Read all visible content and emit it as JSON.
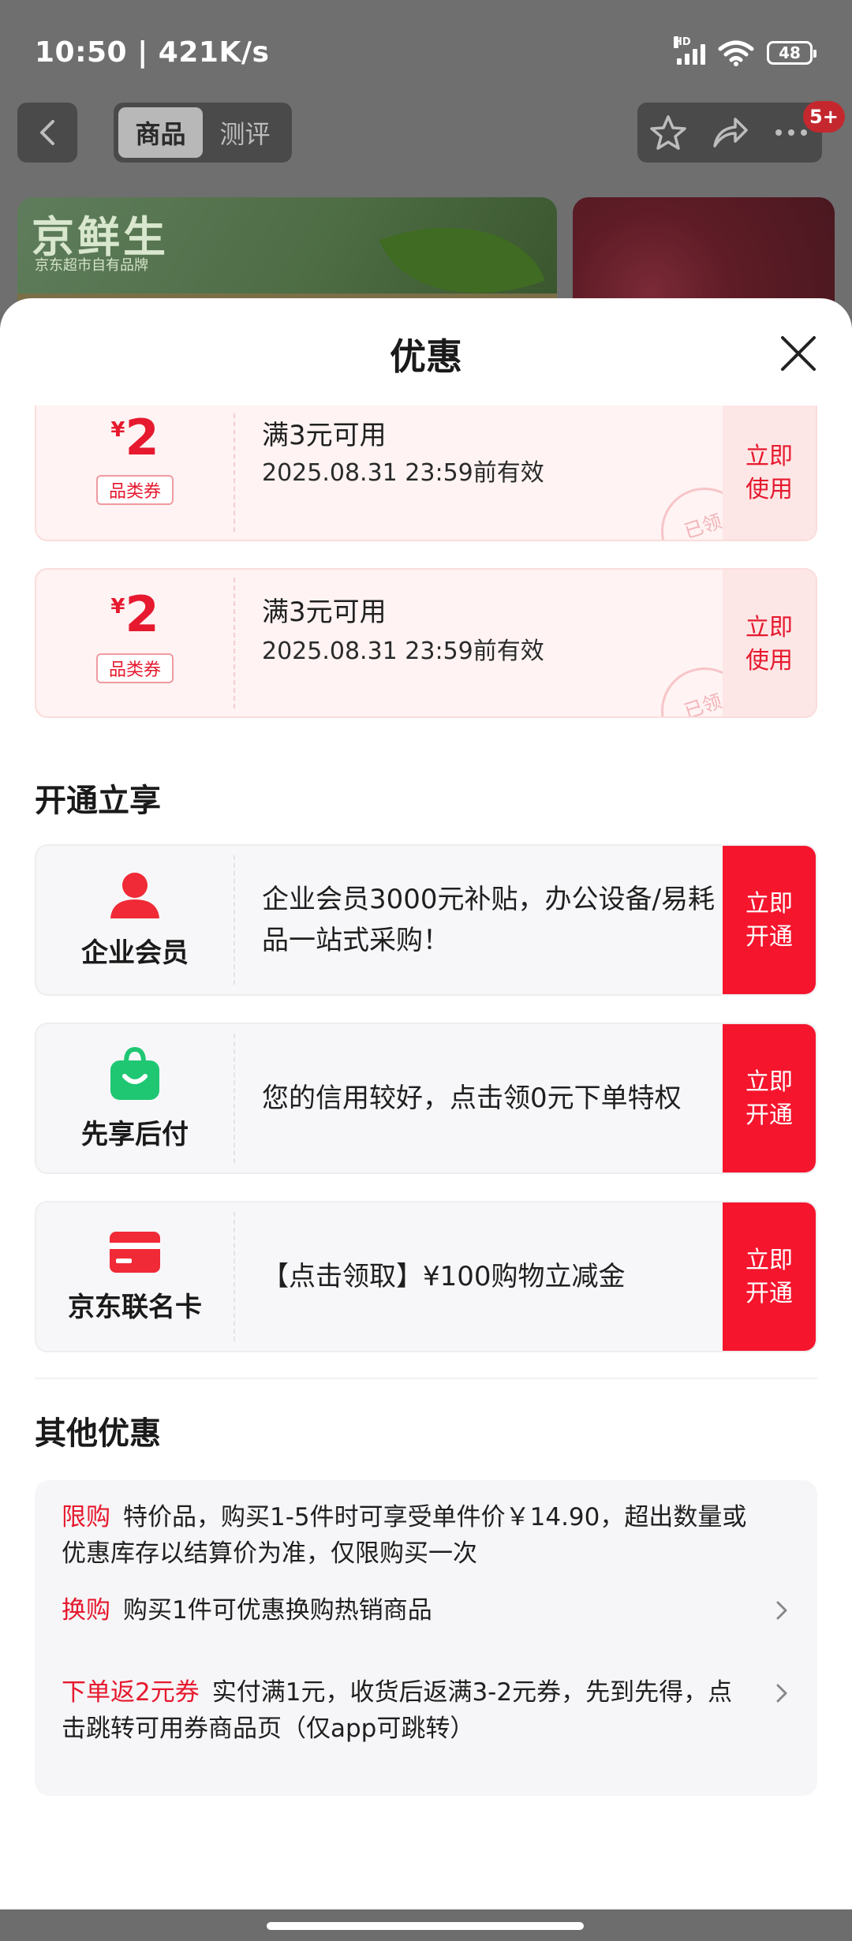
{
  "status_bar": {
    "time": "10:50 | 421K/s",
    "battery": "48",
    "network": "HD"
  },
  "nav": {
    "tabs": [
      "商品",
      "测评"
    ],
    "active_tab": 0,
    "badge": "5+"
  },
  "background_banner": {
    "brand": "京鲜生",
    "sub": "京东超市自有品牌"
  },
  "sheet": {
    "title": "优惠"
  },
  "coupons": [
    {
      "currency": "¥",
      "amount": "2",
      "type": "品类券",
      "condition": "满3元可用",
      "validity": "2025.08.31 23:59前有效",
      "action_line1": "立即",
      "action_line2": "使用",
      "stamp": "已领"
    },
    {
      "currency": "¥",
      "amount": "2",
      "type": "品类券",
      "condition": "满3元可用",
      "validity": "2025.08.31 23:59前有效",
      "action_line1": "立即",
      "action_line2": "使用",
      "stamp": "已领"
    }
  ],
  "sections": {
    "open": "开通立享",
    "other": "其他优惠"
  },
  "services": [
    {
      "icon": "person-icon",
      "name": "企业会员",
      "desc": " 企业会员3000元补贴，办公设备/易耗品一站式采购！",
      "action_line1": "立即",
      "action_line2": "开通"
    },
    {
      "icon": "shopping-bag-icon",
      "name": "先享后付",
      "desc": "您的信用较好，点击领0元下单特权",
      "action_line1": "立即",
      "action_line2": "开通"
    },
    {
      "icon": "credit-card-icon",
      "name": "京东联名卡",
      "desc": "【点击领取】¥100购物立减金",
      "action_line1": "立即",
      "action_line2": "开通"
    }
  ],
  "other_offers": [
    {
      "label": "限购",
      "text": "特价品，购买1-5件时可享受单件价￥14.90，超出数量或优惠库存以结算价为准，仅限购买一次"
    },
    {
      "label": "换购",
      "text": "购买1件可优惠换购热销商品"
    },
    {
      "label": "下单返2元券",
      "text": "实付满1元，收货后返满3-2元券，先到先得，点击跳转可用券商品页（仅app可跳转）"
    }
  ],
  "colors": {
    "accent": "#e6192e",
    "action_red": "#f5152d",
    "coupon_bg": "#fff3f3"
  }
}
